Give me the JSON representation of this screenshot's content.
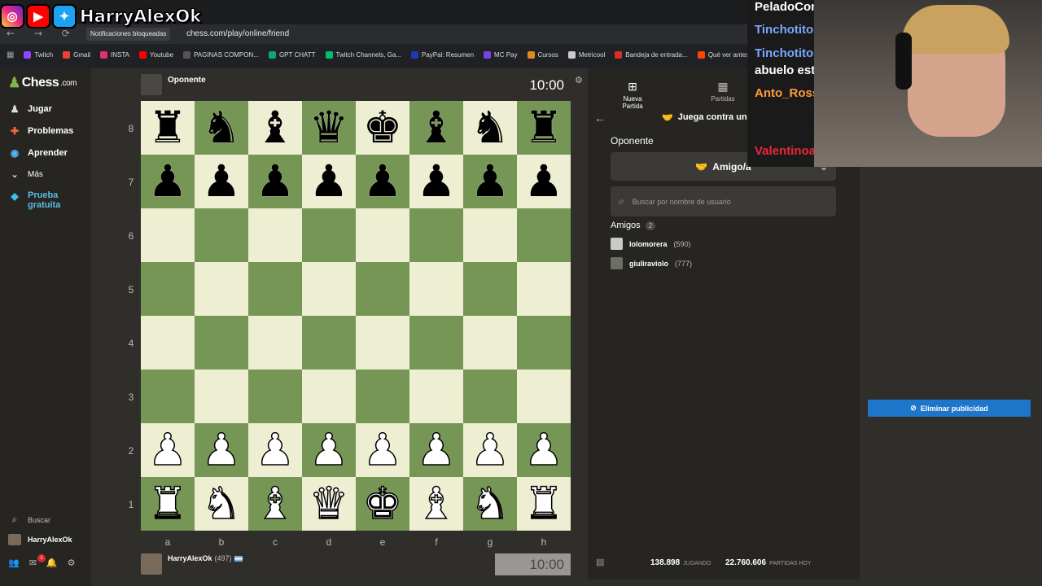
{
  "browser": {
    "notice": "Notificaciones bloqueadas",
    "url": "chess.com/play/online/friend",
    "nav_icons": "← → ⟳ ⌂",
    "bookmarks": [
      {
        "label": "Twitch",
        "color": "#9146ff"
      },
      {
        "label": "Gmail",
        "color": "#ea4335"
      },
      {
        "label": "INSTA",
        "color": "#e1306c"
      },
      {
        "label": "Youtube",
        "color": "#ff0000"
      },
      {
        "label": "PAGINAS COMPON...",
        "color": "#555555"
      },
      {
        "label": "GPT CHATT",
        "color": "#10a37f"
      },
      {
        "label": "Twitch Channels, Ga...",
        "color": "#00c16a"
      },
      {
        "label": "PayPal: Resumen",
        "color": "#1a3bb3"
      },
      {
        "label": "MC Pay",
        "color": "#7b3fe4"
      },
      {
        "label": "Cursos",
        "color": "#e08a1e"
      },
      {
        "label": "Metricool",
        "color": "#cccccc"
      },
      {
        "label": "Bandeja de entrada...",
        "color": "#d93025"
      },
      {
        "label": "Qué ver antes de",
        "color": "#ff4500"
      }
    ]
  },
  "overlay": {
    "name": "HarryAlexOk"
  },
  "sidebar": {
    "logo_text": "Chess",
    "logo_suffix": ".com",
    "items": [
      {
        "label": "Jugar",
        "icon": "play-icon"
      },
      {
        "label": "Problemas",
        "icon": "puzzle-icon"
      },
      {
        "label": "Aprender",
        "icon": "learn-icon"
      },
      {
        "label": "Más",
        "icon": "chevron-down-icon"
      },
      {
        "label": "Prueba gratuita",
        "icon": "diamond-icon"
      }
    ],
    "search": "Buscar",
    "user": "HarryAlexOk"
  },
  "game": {
    "opponent": "Oponente",
    "opponent_clock": "10:00",
    "player": "HarryAlexOk",
    "player_rating": "(497)",
    "player_clock": "10:00",
    "files": [
      "a",
      "b",
      "c",
      "d",
      "e",
      "f",
      "g",
      "h"
    ],
    "ranks": [
      "8",
      "7",
      "6",
      "5",
      "4",
      "3",
      "2",
      "1"
    ],
    "position": [
      "rnbqkbnr",
      "pppppppp",
      "........",
      "........",
      "........",
      "........",
      "PPPPPPPP",
      "RNBQKBNR"
    ]
  },
  "panel": {
    "tabs": [
      {
        "label": "Nueva Partida"
      },
      {
        "label": "Partidas"
      }
    ],
    "heading": "Juega contra un",
    "opponent_label": "Oponente",
    "opponent_choice": "Amigo/a",
    "search_placeholder": "Buscar por nombre de usuario",
    "friends_label": "Amigos",
    "friends_count": "2",
    "friends": [
      {
        "name": "lolomorera",
        "rating": "(590)"
      },
      {
        "name": "giuliraviolo",
        "rating": "(777)"
      }
    ],
    "stats": [
      {
        "value": "138.898",
        "label": "JUGANDO"
      },
      {
        "value": "22.760.606",
        "label": "PARTIDAS HOY"
      }
    ]
  },
  "ads": {
    "remove_label": "Eliminar publicidad"
  },
  "chat": {
    "lines": [
      {
        "text": "PeladoCon",
        "color": "#ffffff"
      },
      {
        "text": "Tinchotitol",
        "color": "#7aa7ff"
      },
      {
        "text": "Tinchotitol",
        "color": "#7aa7ff"
      },
      {
        "text": "abuelo esta",
        "color": "#ffffff"
      },
      {
        "text": "Anto_Ross",
        "color": "#ff9d3b"
      },
      {
        "text": "Valentinoandino:",
        "color": "#e8283c"
      }
    ]
  }
}
